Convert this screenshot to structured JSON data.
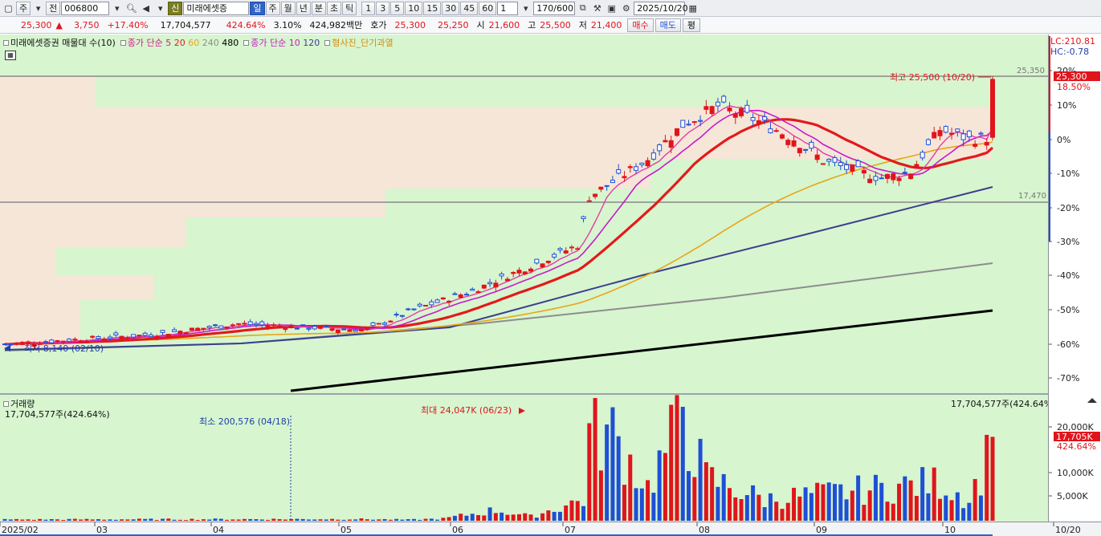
{
  "toolbar": {
    "market_label": "주",
    "prev_label": "전",
    "code": "006800",
    "badge": "신",
    "stock_name": "미래에셋증",
    "periods": [
      "일",
      "주",
      "월",
      "년",
      "분",
      "초",
      "틱"
    ],
    "active_period": "일",
    "intervals": [
      "1",
      "3",
      "5",
      "10",
      "15",
      "30",
      "45",
      "60"
    ],
    "multiplier": "1",
    "count": "170/600",
    "date": "2025/10/20"
  },
  "quote": {
    "price": "25,300",
    "change": "3,750",
    "change_pct": "+17.40%",
    "volume": "17,704,577",
    "volume_ratio": "424.64%",
    "turnover": "3.10%",
    "amount": "424,982백만",
    "ask_label": "호가",
    "ask": "25,300",
    "bid": "25,250",
    "open_label": "시",
    "open": "21,600",
    "high_label": "고",
    "high": "25,500",
    "low_label": "저",
    "low": "21,400",
    "buy_label": "매수",
    "sell_label": "매도",
    "eval_label": "평"
  },
  "legend": {
    "main": "미래에셋증권 매물대 수(10)",
    "ma_label": "종가 단순 5",
    "ma_periods": [
      "20",
      "60",
      "240",
      "480"
    ],
    "ma2_label": "종가 단순 10",
    "ma2_period": "120",
    "signal": "형사진_단기과열"
  },
  "price_axis": {
    "lc": "LC:210.81",
    "hc": "HC:-0.78",
    "current": "25,300",
    "current_pct": "18.50%",
    "ticks": [
      "20%",
      "10%",
      "0%",
      "-10%",
      "-20%",
      "-30%",
      "-40%",
      "-50%",
      "-60%",
      "-70%"
    ],
    "hline_high": "25,350",
    "hline_low": "17,470"
  },
  "annotations": {
    "high": "최고 25,500 (10/20)",
    "low": "최저 8,140 (02/10)"
  },
  "volume": {
    "title": "거래량",
    "left_value": "17,704,577주(424.64%)",
    "right_value": "17,704,577주(424.64%)",
    "min_label": "최소 200,576 (04/18)",
    "max_label": "최대 24,047K (06/23)",
    "axis_ticks": [
      "20,000K",
      "10,000K",
      "5,000K"
    ],
    "current": "17,705K",
    "current_pct": "424.64%"
  },
  "x_axis": {
    "labels": [
      "2025/02",
      "03",
      "04",
      "05",
      "06",
      "07",
      "08",
      "09",
      "10",
      "10/20"
    ]
  },
  "colors": {
    "up": "#e0151c",
    "down": "#1f4fd6",
    "ma5": "#e23fa8",
    "ma10": "#c81acb",
    "ma20": "#e31a1a",
    "ma60": "#e8a617",
    "ma120": "#3c3f8f",
    "ma240": "#8d8d8d",
    "ma480": "#000000",
    "background": "#d7f5cf",
    "volume_profile": "#f6e6d8"
  }
}
